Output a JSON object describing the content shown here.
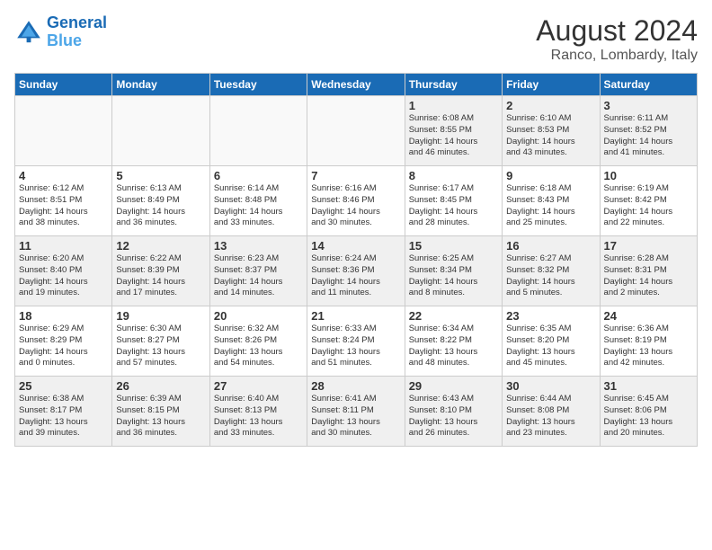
{
  "header": {
    "logo_line1": "General",
    "logo_line2": "Blue",
    "month": "August 2024",
    "location": "Ranco, Lombardy, Italy"
  },
  "weekdays": [
    "Sunday",
    "Monday",
    "Tuesday",
    "Wednesday",
    "Thursday",
    "Friday",
    "Saturday"
  ],
  "weeks": [
    [
      {
        "day": "",
        "info": "",
        "empty": true
      },
      {
        "day": "",
        "info": "",
        "empty": true
      },
      {
        "day": "",
        "info": "",
        "empty": true
      },
      {
        "day": "",
        "info": "",
        "empty": true
      },
      {
        "day": "1",
        "info": "Sunrise: 6:08 AM\nSunset: 8:55 PM\nDaylight: 14 hours\nand 46 minutes."
      },
      {
        "day": "2",
        "info": "Sunrise: 6:10 AM\nSunset: 8:53 PM\nDaylight: 14 hours\nand 43 minutes."
      },
      {
        "day": "3",
        "info": "Sunrise: 6:11 AM\nSunset: 8:52 PM\nDaylight: 14 hours\nand 41 minutes."
      }
    ],
    [
      {
        "day": "4",
        "info": "Sunrise: 6:12 AM\nSunset: 8:51 PM\nDaylight: 14 hours\nand 38 minutes."
      },
      {
        "day": "5",
        "info": "Sunrise: 6:13 AM\nSunset: 8:49 PM\nDaylight: 14 hours\nand 36 minutes."
      },
      {
        "day": "6",
        "info": "Sunrise: 6:14 AM\nSunset: 8:48 PM\nDaylight: 14 hours\nand 33 minutes."
      },
      {
        "day": "7",
        "info": "Sunrise: 6:16 AM\nSunset: 8:46 PM\nDaylight: 14 hours\nand 30 minutes."
      },
      {
        "day": "8",
        "info": "Sunrise: 6:17 AM\nSunset: 8:45 PM\nDaylight: 14 hours\nand 28 minutes."
      },
      {
        "day": "9",
        "info": "Sunrise: 6:18 AM\nSunset: 8:43 PM\nDaylight: 14 hours\nand 25 minutes."
      },
      {
        "day": "10",
        "info": "Sunrise: 6:19 AM\nSunset: 8:42 PM\nDaylight: 14 hours\nand 22 minutes."
      }
    ],
    [
      {
        "day": "11",
        "info": "Sunrise: 6:20 AM\nSunset: 8:40 PM\nDaylight: 14 hours\nand 19 minutes."
      },
      {
        "day": "12",
        "info": "Sunrise: 6:22 AM\nSunset: 8:39 PM\nDaylight: 14 hours\nand 17 minutes."
      },
      {
        "day": "13",
        "info": "Sunrise: 6:23 AM\nSunset: 8:37 PM\nDaylight: 14 hours\nand 14 minutes."
      },
      {
        "day": "14",
        "info": "Sunrise: 6:24 AM\nSunset: 8:36 PM\nDaylight: 14 hours\nand 11 minutes."
      },
      {
        "day": "15",
        "info": "Sunrise: 6:25 AM\nSunset: 8:34 PM\nDaylight: 14 hours\nand 8 minutes."
      },
      {
        "day": "16",
        "info": "Sunrise: 6:27 AM\nSunset: 8:32 PM\nDaylight: 14 hours\nand 5 minutes."
      },
      {
        "day": "17",
        "info": "Sunrise: 6:28 AM\nSunset: 8:31 PM\nDaylight: 14 hours\nand 2 minutes."
      }
    ],
    [
      {
        "day": "18",
        "info": "Sunrise: 6:29 AM\nSunset: 8:29 PM\nDaylight: 14 hours\nand 0 minutes."
      },
      {
        "day": "19",
        "info": "Sunrise: 6:30 AM\nSunset: 8:27 PM\nDaylight: 13 hours\nand 57 minutes."
      },
      {
        "day": "20",
        "info": "Sunrise: 6:32 AM\nSunset: 8:26 PM\nDaylight: 13 hours\nand 54 minutes."
      },
      {
        "day": "21",
        "info": "Sunrise: 6:33 AM\nSunset: 8:24 PM\nDaylight: 13 hours\nand 51 minutes."
      },
      {
        "day": "22",
        "info": "Sunrise: 6:34 AM\nSunset: 8:22 PM\nDaylight: 13 hours\nand 48 minutes."
      },
      {
        "day": "23",
        "info": "Sunrise: 6:35 AM\nSunset: 8:20 PM\nDaylight: 13 hours\nand 45 minutes."
      },
      {
        "day": "24",
        "info": "Sunrise: 6:36 AM\nSunset: 8:19 PM\nDaylight: 13 hours\nand 42 minutes."
      }
    ],
    [
      {
        "day": "25",
        "info": "Sunrise: 6:38 AM\nSunset: 8:17 PM\nDaylight: 13 hours\nand 39 minutes."
      },
      {
        "day": "26",
        "info": "Sunrise: 6:39 AM\nSunset: 8:15 PM\nDaylight: 13 hours\nand 36 minutes."
      },
      {
        "day": "27",
        "info": "Sunrise: 6:40 AM\nSunset: 8:13 PM\nDaylight: 13 hours\nand 33 minutes."
      },
      {
        "day": "28",
        "info": "Sunrise: 6:41 AM\nSunset: 8:11 PM\nDaylight: 13 hours\nand 30 minutes."
      },
      {
        "day": "29",
        "info": "Sunrise: 6:43 AM\nSunset: 8:10 PM\nDaylight: 13 hours\nand 26 minutes."
      },
      {
        "day": "30",
        "info": "Sunrise: 6:44 AM\nSunset: 8:08 PM\nDaylight: 13 hours\nand 23 minutes."
      },
      {
        "day": "31",
        "info": "Sunrise: 6:45 AM\nSunset: 8:06 PM\nDaylight: 13 hours\nand 20 minutes."
      }
    ]
  ]
}
